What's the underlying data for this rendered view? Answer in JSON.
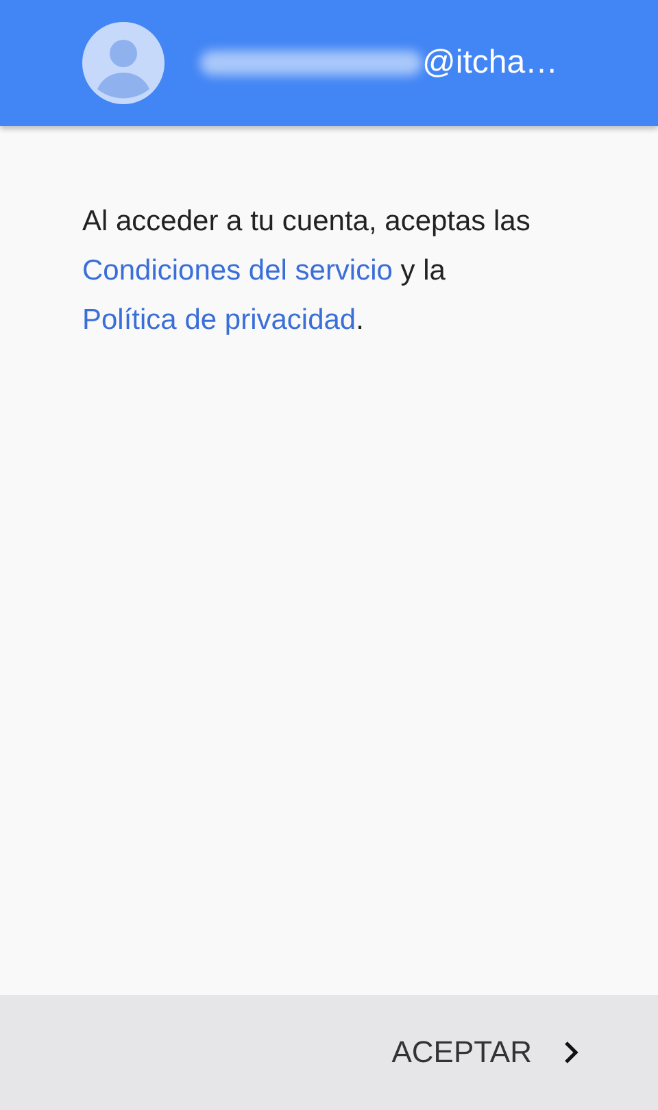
{
  "account": {
    "email": "@itcha…"
  },
  "terms": [
    {
      "kind": "text",
      "text": "Al acceder a tu cuenta, aceptas las "
    },
    {
      "kind": "link",
      "text": "Condiciones del servicio"
    },
    {
      "kind": "text",
      "text": " y la "
    },
    {
      "kind": "link",
      "text": "Política de privacidad"
    },
    {
      "kind": "text",
      "text": "."
    }
  ],
  "footer": {
    "button": "ACEPTAR"
  }
}
